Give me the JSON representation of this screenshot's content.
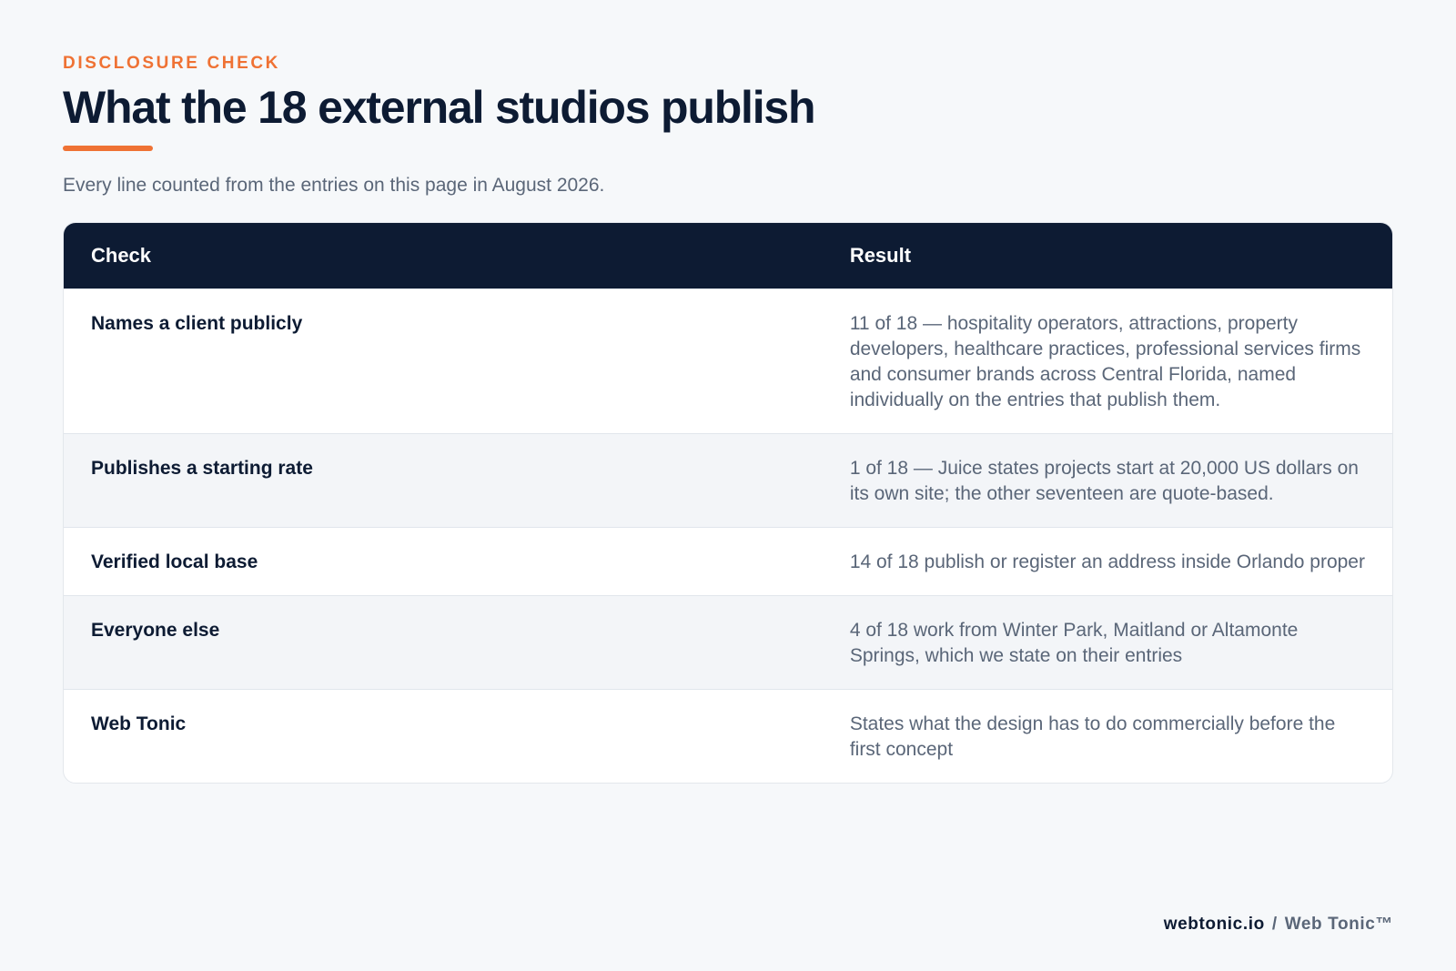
{
  "header": {
    "eyebrow": "DISCLOSURE CHECK",
    "title": "What the 18 external studios publish",
    "subtitle": "Every line counted from the entries on this page in August 2026."
  },
  "table": {
    "columns": {
      "check": "Check",
      "result": "Result"
    },
    "rows": [
      {
        "check": "Names a client publicly",
        "result": "11 of 18 — hospitality operators, attractions, property developers, healthcare practices, professional services firms and consumer brands across Central Florida, named individually on the entries that publish them."
      },
      {
        "check": "Publishes a starting rate",
        "result": "1 of 18 — Juice states projects start at 20,000 US dollars on its own site; the other seventeen are quote-based."
      },
      {
        "check": "Verified local base",
        "result": "14 of 18 publish or register an address inside Orlando proper"
      },
      {
        "check": "Everyone else",
        "result": "4 of 18 work from Winter Park, Maitland or Altamonte Springs, which we state on their entries"
      },
      {
        "check": "Web Tonic",
        "result": "States what the design has to do commercially before the first concept"
      }
    ]
  },
  "footer": {
    "domain": "webtonic.io",
    "separator": "/",
    "brand": "Web Tonic™"
  },
  "colors": {
    "accent": "#ef7234",
    "navy": "#0d1b33",
    "muted": "#5a6678",
    "background": "#f6f8fa"
  }
}
